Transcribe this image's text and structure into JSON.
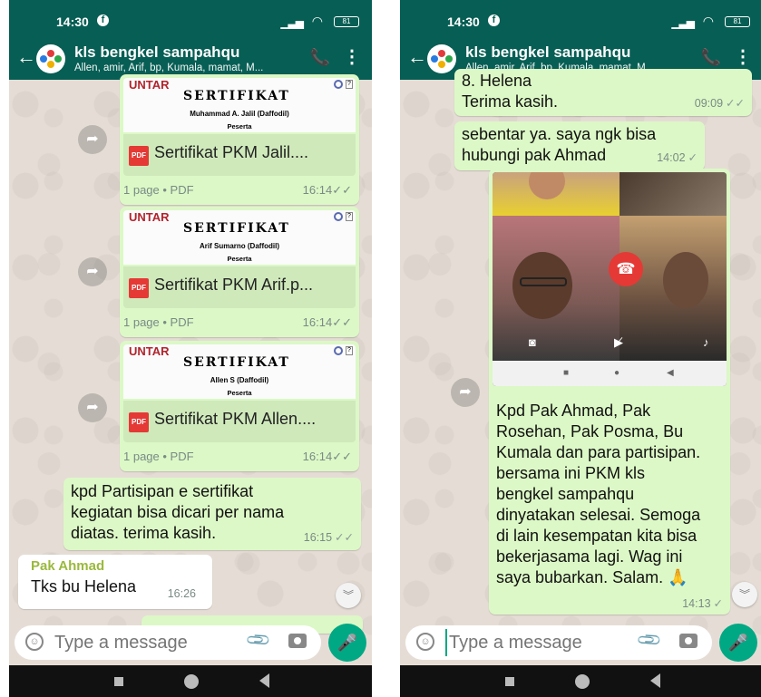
{
  "status": {
    "time": "14:30",
    "battery": "81"
  },
  "chat": {
    "title": "kls bengkel sampahqu",
    "members": "Allen, amir, Arif, bp, Kumala, mamat, M..."
  },
  "left": {
    "pdfs": [
      {
        "org": "UNTAR",
        "heading": "SERTIFIKAT",
        "name": "Muhammad A. Jalil (Daffodil)",
        "role": "Peserta",
        "file": "Sertifikat PKM Jalil....",
        "pages": "1 page • PDF",
        "time": "16:14"
      },
      {
        "org": "UNTAR",
        "heading": "SERTIFIKAT",
        "name": "Arif Sumarno (Daffodil)",
        "role": "Peserta",
        "file": "Sertifikat PKM Arif.p...",
        "pages": "1 page • PDF",
        "time": "16:14"
      },
      {
        "org": "UNTAR",
        "heading": "SERTIFIKAT",
        "name": "Allen S (Daffodil)",
        "role": "Peserta",
        "file": "Sertifikat PKM Allen....",
        "pages": "1 page • PDF",
        "time": "16:14"
      }
    ],
    "msg1": {
      "lines": [
        "kpd Partisipan e sertifikat",
        "kegiatan bisa dicari per nama",
        "diatas. terima kasih."
      ],
      "time": "16:15"
    },
    "msg2": {
      "sender": "Pak Ahmad",
      "text": "Tks bu Helena",
      "time": "16:26"
    }
  },
  "right": {
    "msg0": {
      "partial": "8. Helena",
      "text": "Terima kasih.",
      "time": "09:09"
    },
    "msg1": {
      "lines": [
        "sebentar ya. saya ngk bisa",
        "hubungi pak Ahmad"
      ],
      "time": "14:02"
    },
    "msg2": {
      "lines": [
        "Kpd Pak Ahmad, Pak",
        "Rosehan, Pak Posma, Bu",
        "Kumala dan para partisipan.",
        "bersama ini PKM kls",
        "bengkel sampahqu",
        "dinyatakan selesai. Semoga",
        "di lain kesempatan kita bisa",
        "bekerjasama lagi.  Wag ini",
        "saya bubarkan. Salam. 🙏"
      ],
      "time": "14:13"
    }
  },
  "input": {
    "placeholder": "Type a message"
  },
  "icons": {
    "back": "arrow-left-icon",
    "call": "add-call-icon",
    "menu": "more-vert-icon",
    "emoji": "emoji-icon",
    "attach": "paperclip-icon",
    "camera": "camera-icon",
    "mic": "mic-icon",
    "forward": "forward-icon",
    "pdf": "pdf-file-icon"
  },
  "colors": {
    "header": "#075e54",
    "outgoing": "#dcf8c6",
    "accent": "#00a884",
    "sender": "#9ab93c"
  }
}
